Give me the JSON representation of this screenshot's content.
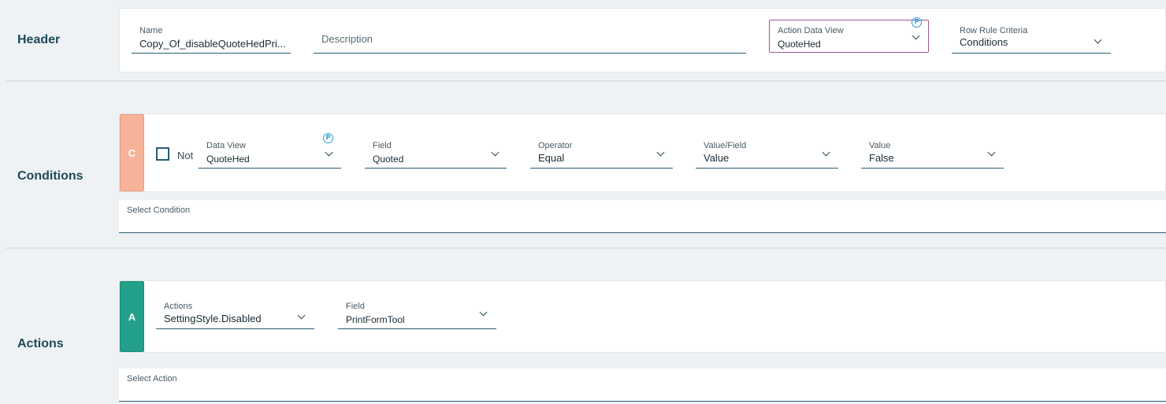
{
  "sections": {
    "header": "Header",
    "conditions": "Conditions",
    "actions": "Actions"
  },
  "header": {
    "name": {
      "label": "Name",
      "value": "Copy_Of_disableQuoteHedPri..."
    },
    "description": {
      "placeholder": "Description"
    },
    "action_data_view": {
      "label": "Action Data View",
      "value": "QuoteHed",
      "badge": "P"
    },
    "row_rule_criteria": {
      "label": "Row Rule Criteria",
      "value": "Conditions"
    }
  },
  "condition": {
    "tag": "C",
    "tag_color": "#f7b39a",
    "not_label": "Not",
    "not_checked": false,
    "data_view": {
      "label": "Data View",
      "value": "QuoteHed",
      "badge": "P"
    },
    "field": {
      "label": "Field",
      "value": "Quoted"
    },
    "operator": {
      "label": "Operator",
      "value": "Equal"
    },
    "value_field": {
      "label": "Value/Field",
      "value": "Value"
    },
    "value": {
      "label": "Value",
      "value": "False"
    }
  },
  "select_condition": {
    "label": "Select Condition"
  },
  "action": {
    "tag": "A",
    "tag_color": "#22a08a",
    "actions": {
      "label": "Actions",
      "value": "SettingStyle.Disabled"
    },
    "field": {
      "label": "Field",
      "value": "PrintFormTool"
    }
  },
  "select_action": {
    "label": "Select Action"
  },
  "colors": {
    "accent_border": "#a0588a",
    "badge": "#2c9fd6",
    "underline": "#2a5d74"
  }
}
